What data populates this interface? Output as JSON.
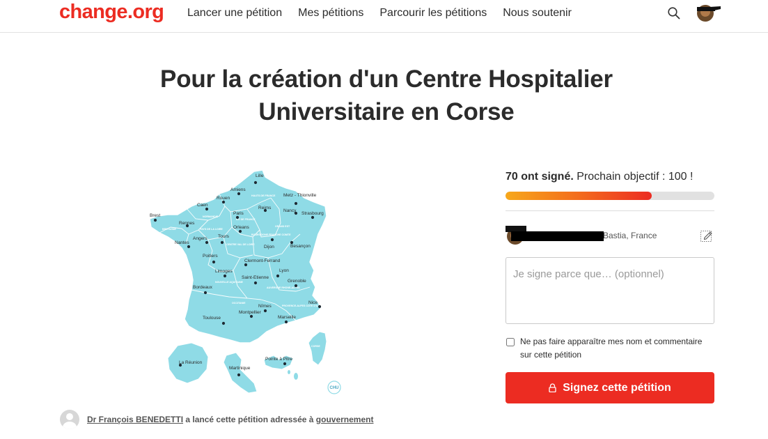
{
  "header": {
    "logo": "change.org",
    "nav": [
      "Lancer une pétition",
      "Mes pétitions",
      "Parcourir les pétitions",
      "Nous soutenir"
    ],
    "icons": [
      "search-icon",
      "user-avatar"
    ]
  },
  "petition": {
    "title": "Pour la création d'un Centre Hospitalier Universitaire en Corse"
  },
  "map": {
    "cities": [
      "Lille",
      "Amiens",
      "Metz - Thionville",
      "Rouen",
      "Caen",
      "Reims",
      "Brest",
      "Paris",
      "Nancy",
      "Strasbourg",
      "Rennes",
      "Orleans",
      "Angers",
      "Tours",
      "Nantes",
      "Dijon",
      "Besançon",
      "Poitiers",
      "Clermont-Ferrand",
      "Limoges",
      "Lyon",
      "Saint-Etienne",
      "Grenoble",
      "Bordeaux",
      "Nîmes",
      "Nice",
      "Montpellier",
      "Marseille",
      "Toulouse",
      "La Réunion",
      "Pointe à Pitre",
      "Martinique"
    ],
    "regions": [
      "HAUTS DE FRANCE",
      "NORMANDIE",
      "ILE DE FRANCE",
      "GRAND EST",
      "BRETAGNE",
      "PAYS DE LA LOIRE",
      "CENTRE VAL DE LOIRE",
      "BOURGOGNE FRANCHE COMTE",
      "NOUVELLE AQUITAINE",
      "AUVERGNE RHONE-ALPES",
      "OCCITANIE",
      "PROVENCE-ALPES COTE D'AZUR",
      "CORSE"
    ],
    "badge": "CHU"
  },
  "author": {
    "name": "Dr François BENEDETTI",
    "middle": " a lancé cette pétition adressée à ",
    "target": "gouvernement"
  },
  "sign": {
    "signed_bold": "70 ont signé.",
    "next_goal": " Prochain objectif : 100 !",
    "signatures": 70,
    "goal": 100,
    "location": "Bastia, France",
    "reason_placeholder": "Je signe parce que… (optionnel)",
    "privacy_label": "Ne pas faire apparaître mes nom et commentaire sur cette pétition",
    "button_label": "Signez cette pétition"
  },
  "colors": {
    "brand": "#ec2c22",
    "map_fill": "#8fdbe6",
    "progress_start": "#f7a81b",
    "progress_end": "#ec2c22"
  }
}
